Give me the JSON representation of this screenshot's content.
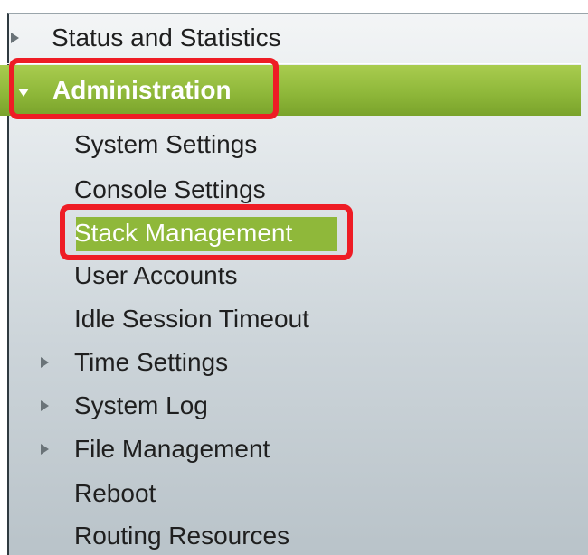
{
  "nav": {
    "status_and_statistics": "Status and Statistics",
    "administration": "Administration",
    "items": [
      {
        "label": "System Settings"
      },
      {
        "label": "Console Settings"
      },
      {
        "label": "Stack Management"
      },
      {
        "label": "User Accounts"
      },
      {
        "label": "Idle Session Timeout"
      },
      {
        "label": "Time Settings"
      },
      {
        "label": "System Log"
      },
      {
        "label": "File Management"
      },
      {
        "label": "Reboot"
      },
      {
        "label": "Routing Resources"
      }
    ]
  },
  "colors": {
    "selected_green": "#8fb83a",
    "highlight_red": "#ee1c25"
  },
  "icons": {
    "collapsed": "triangle-right-icon",
    "expanded": "triangle-down-icon"
  }
}
